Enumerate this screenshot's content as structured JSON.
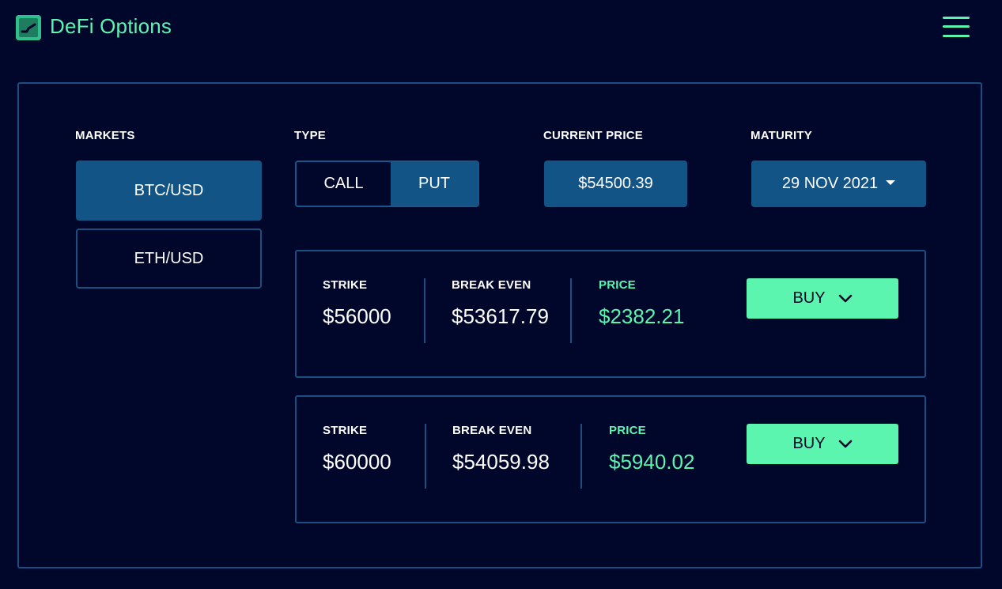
{
  "header": {
    "app_title": "DeFi Options",
    "logo_icon": "chart-line-icon",
    "menu_icon": "hamburger-menu-icon"
  },
  "colors": {
    "background": "#01072a",
    "accent_green": "#5cf5b0",
    "selected_blue": "#115485",
    "border_blue": "#1b4f82"
  },
  "markets": {
    "label": "MARKETS",
    "items": [
      {
        "label": "BTC/USD",
        "selected": true
      },
      {
        "label": "ETH/USD",
        "selected": false
      }
    ]
  },
  "type": {
    "label": "TYPE",
    "options": [
      {
        "label": "CALL",
        "selected": false
      },
      {
        "label": "PUT",
        "selected": true
      }
    ]
  },
  "current_price": {
    "label": "CURRENT PRICE",
    "value": "$54500.39"
  },
  "maturity": {
    "label": "MATURITY",
    "selected": "29 NOV 2021"
  },
  "options": [
    {
      "strike_label": "STRIKE",
      "strike": "$56000",
      "break_even_label": "BREAK EVEN",
      "break_even": "$53617.79",
      "price_label": "PRICE",
      "price": "$2382.21",
      "buy_label": "BUY"
    },
    {
      "strike_label": "STRIKE",
      "strike": "$60000",
      "break_even_label": "BREAK EVEN",
      "break_even": "$54059.98",
      "price_label": "PRICE",
      "price": "$5940.02",
      "buy_label": "BUY"
    }
  ]
}
